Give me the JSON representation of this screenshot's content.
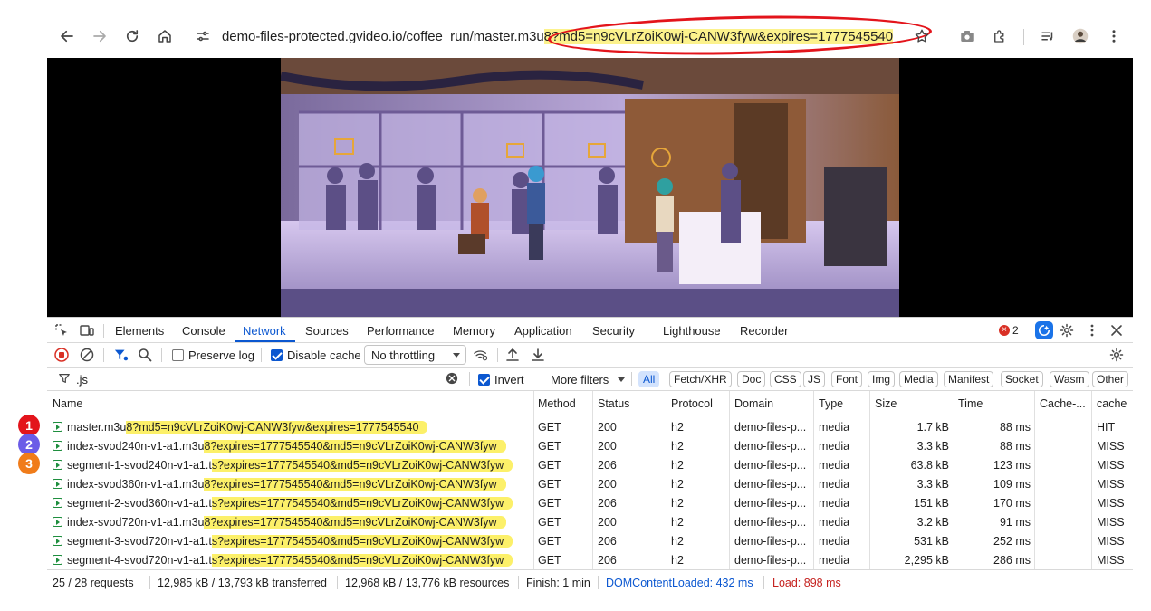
{
  "browser": {
    "url_plain": "demo-files-protected.gvideo.io/coffee_run/master.m3u",
    "url_highlight": "8?md5=n9cVLrZoiK0wj-CANW3fyw&expires=1777545540"
  },
  "devtools": {
    "tabs": [
      "Elements",
      "Console",
      "Network",
      "Sources",
      "Performance",
      "Memory",
      "Application",
      "Security",
      "Lighthouse",
      "Recorder"
    ],
    "active_tab": "Network",
    "error_count": "2",
    "preserve_log_label": "Preserve log",
    "disable_cache_label": "Disable cache",
    "throttling_value": "No throttling",
    "filter_value": ".js",
    "invert_label": "Invert",
    "more_filters_label": "More filters",
    "type_filters": [
      "All",
      "Fetch/XHR",
      "Doc",
      "CSS",
      "JS",
      "Font",
      "Img",
      "Media",
      "Manifest",
      "Socket",
      "Wasm",
      "Other"
    ],
    "columns": [
      "Name",
      "Method",
      "Status",
      "Protocol",
      "Domain",
      "Type",
      "Size",
      "Time",
      "Cache-...",
      "cache"
    ],
    "rows": [
      {
        "name_plain": "master.m3u",
        "name_highlight": "8?md5=n9cVLrZoiK0wj-CANW3fyw&expires=1777545540",
        "method": "GET",
        "status": "200",
        "protocol": "h2",
        "domain": "demo-files-p...",
        "type": "media",
        "size": "1.7 kB",
        "time": "88 ms",
        "cache_short": "",
        "cache": "HIT"
      },
      {
        "name_plain": "index-svod240n-v1-a1.m3u",
        "name_highlight": "8?expires=1777545540&md5=n9cVLrZoiK0wj-CANW3fyw",
        "method": "GET",
        "status": "200",
        "protocol": "h2",
        "domain": "demo-files-p...",
        "type": "media",
        "size": "3.3 kB",
        "time": "88 ms",
        "cache_short": "",
        "cache": "MISS"
      },
      {
        "name_plain": "segment-1-svod240n-v1-a1.t",
        "name_highlight": "s?expires=1777545540&md5=n9cVLrZoiK0wj-CANW3fyw",
        "method": "GET",
        "status": "206",
        "protocol": "h2",
        "domain": "demo-files-p...",
        "type": "media",
        "size": "63.8 kB",
        "time": "123 ms",
        "cache_short": "",
        "cache": "MISS"
      },
      {
        "name_plain": "index-svod360n-v1-a1.m3u",
        "name_highlight": "8?expires=1777545540&md5=n9cVLrZoiK0wj-CANW3fyw",
        "method": "GET",
        "status": "200",
        "protocol": "h2",
        "domain": "demo-files-p...",
        "type": "media",
        "size": "3.3 kB",
        "time": "109 ms",
        "cache_short": "",
        "cache": "MISS"
      },
      {
        "name_plain": "segment-2-svod360n-v1-a1.t",
        "name_highlight": "s?expires=1777545540&md5=n9cVLrZoiK0wj-CANW3fyw",
        "method": "GET",
        "status": "206",
        "protocol": "h2",
        "domain": "demo-files-p...",
        "type": "media",
        "size": "151 kB",
        "time": "170 ms",
        "cache_short": "",
        "cache": "MISS"
      },
      {
        "name_plain": "index-svod720n-v1-a1.m3u",
        "name_highlight": "8?expires=1777545540&md5=n9cVLrZoiK0wj-CANW3fyw",
        "method": "GET",
        "status": "200",
        "protocol": "h2",
        "domain": "demo-files-p...",
        "type": "media",
        "size": "3.2 kB",
        "time": "91 ms",
        "cache_short": "",
        "cache": "MISS"
      },
      {
        "name_plain": "segment-3-svod720n-v1-a1.t",
        "name_highlight": "s?expires=1777545540&md5=n9cVLrZoiK0wj-CANW3fyw",
        "method": "GET",
        "status": "206",
        "protocol": "h2",
        "domain": "demo-files-p...",
        "type": "media",
        "size": "531 kB",
        "time": "252 ms",
        "cache_short": "",
        "cache": "MISS"
      },
      {
        "name_plain": "segment-4-svod720n-v1-a1.t",
        "name_highlight": "s?expires=1777545540&md5=n9cVLrZoiK0wj-CANW3fyw",
        "method": "GET",
        "status": "206",
        "protocol": "h2",
        "domain": "demo-files-p...",
        "type": "media",
        "size": "2,295 kB",
        "time": "286 ms",
        "cache_short": "",
        "cache": "MISS"
      }
    ],
    "status_bar": {
      "requests": "25 / 28 requests",
      "transferred": "12,985 kB / 13,793 kB transferred",
      "resources": "12,968 kB / 13,776 kB resources",
      "finish": "Finish: 1 min",
      "dom_content_loaded": "DOMContentLoaded: 432 ms",
      "load": "Load: 898 ms"
    }
  },
  "annotations": {
    "badges": [
      {
        "label": "1",
        "color": "#e3141b"
      },
      {
        "label": "2",
        "color": "#6b5ce7"
      },
      {
        "label": "3",
        "color": "#f07c1a"
      }
    ],
    "highlight_color": "#fcf069",
    "ring_color": "#e3141b"
  },
  "colors": {
    "accent": "#0b57d0",
    "dom_loaded": "#0b57d0",
    "load": "#c5221f"
  }
}
